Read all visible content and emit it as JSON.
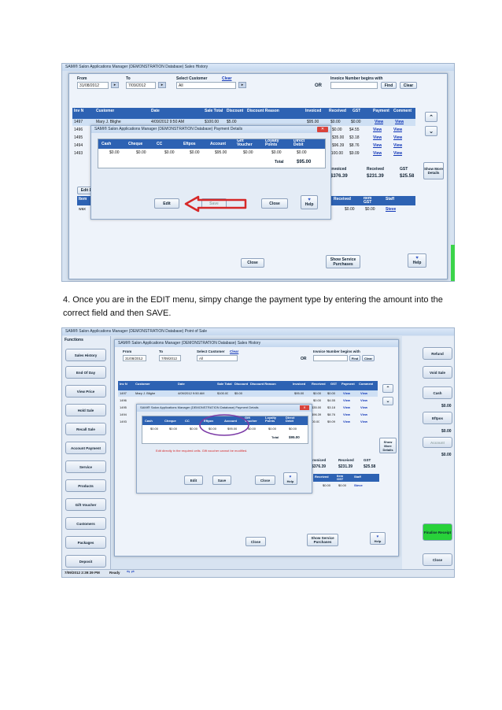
{
  "caption": {
    "line1": "4.  Once you are in the EDIT menu, simpy change the payment type by entering the amount into the",
    "line2": "correct field and then SAVE."
  },
  "sales_history": {
    "title": "SAMI® Salon Applications Manager (DEMONSTRATION Database) Sales History",
    "from_label": "From",
    "from_value": "31/08/2012",
    "to_label": "To",
    "to_value": "7/09/2012",
    "customer_label": "Select Customer",
    "clear_link": "Clear",
    "customer_value": "All",
    "or_label": "OR",
    "invoice_label": "Invoice Number begins with",
    "find_button": "Find",
    "clear_button": "Clear",
    "columns": [
      "Inv No.",
      "Customer",
      "Date",
      "Sale Total",
      "Discount",
      "Discount Reason",
      "Invoiced",
      "Received",
      "GST",
      "Payment",
      "Comment"
    ],
    "first_row": {
      "inv": "1497",
      "customer": "Mary J. Blighe",
      "date": "4/09/2012 9:50 AM",
      "total": "$100.00",
      "discount": "$5.00"
    },
    "inv_numbers": [
      "1496",
      "1495",
      "1494",
      "1493"
    ],
    "right_rows": [
      {
        "invoiced": "$95.00",
        "received": "$0.00",
        "gst": "$0.00",
        "payment": "View",
        "comment": "View"
      },
      {
        "invoiced": "$0.00",
        "received": "$4.55",
        "gst": "$0.00",
        "payment": "View",
        "comment": "View"
      },
      {
        "invoiced": "$35.00",
        "received": "$3.18",
        "gst": "",
        "payment": "View",
        "comment": "View"
      },
      {
        "invoiced": "$96.39",
        "received": "$8.76",
        "gst": "",
        "payment": "View",
        "comment": "View"
      },
      {
        "invoiced": "$100.00",
        "received": "$9.09",
        "gst": "",
        "payment": "View",
        "comment": "View"
      }
    ],
    "show_more": "Show More Details",
    "totals_labels": [
      "Invoiced",
      "Received",
      "GST"
    ],
    "totals_values": [
      "$376.39",
      "$231.39",
      "$25.58"
    ],
    "detail_cols": [
      "Received",
      "Item GST",
      "Staff"
    ],
    "detail_row": {
      "received": "$0.00",
      "gst": "$0.00",
      "staff": "Steve"
    },
    "edit_tab": "Edit D",
    "item_label": "Item",
    "item_value": "wax",
    "close_button": "Close",
    "show_service": "Show Service Purchases",
    "help": "Help"
  },
  "payment_details": {
    "title": "SAMI® Salon Applications Manager (DEMONSTRATION Database) Payment Details",
    "columns": [
      "Cash",
      "Cheque",
      "CC",
      "Eftpos",
      "Account",
      "Gift Voucher",
      "Loyalty Points",
      "Direct Debit"
    ],
    "values": [
      "$0.00",
      "$0.00",
      "$0.00",
      "$0.00",
      "$95.00",
      "$0.00",
      "$0.00",
      "$0.00"
    ],
    "total_label": "Total",
    "total_value": "$95.00",
    "edit_button": "Edit",
    "save_button": "Save",
    "close_button": "Close",
    "help": "Help",
    "edit_note": "Edit directly in the required cells. Gift voucher cannot be modified."
  },
  "pos": {
    "title": "SAMI® Salon Applications Manager (DEMONSTRATION Database) Point of Sale",
    "functions_label": "Functions",
    "side_buttons": [
      "Sales History",
      "End Of Day",
      "View Price",
      "Hold Sale",
      "Recall Sale",
      "Account Payment",
      "Service",
      "Products",
      "Gift Voucher",
      "Customers",
      "Packages",
      "Deposit"
    ],
    "right_buttons": [
      "Refund",
      "Void Sale",
      "Cash",
      "Eftpos",
      "Account"
    ],
    "right_values": [
      "$0.00",
      "$0.00",
      "$0.00"
    ],
    "finalise": "Finalise Receipt",
    "close": "Close",
    "status_time": "7/09/2012 2:39:39 PM",
    "status_ready": "Ready"
  },
  "colors": {
    "header_blue": "#2d62b3",
    "arrow_red": "#d62828",
    "oval_purple": "#7b3aa6",
    "finalise_green": "#28d23a"
  }
}
